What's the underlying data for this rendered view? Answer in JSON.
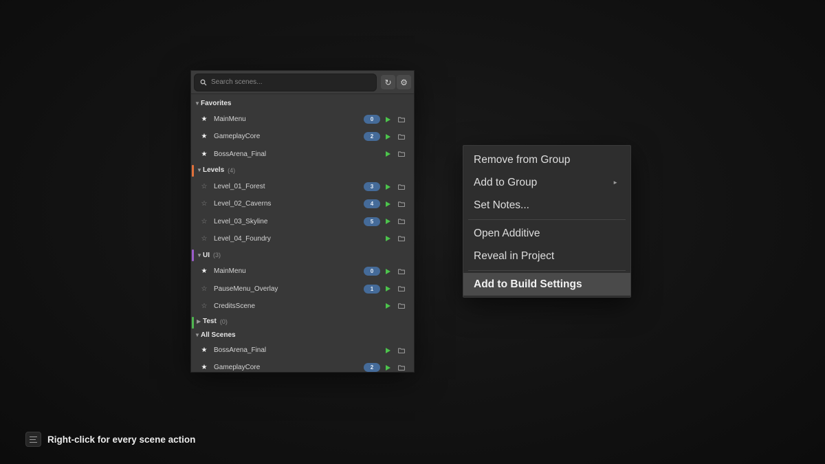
{
  "search": {
    "placeholder": "Search scenes..."
  },
  "toolbar": {
    "refresh_glyph": "↻",
    "settings_glyph": "⚙"
  },
  "groups": {
    "favorites": {
      "label": "Favorites",
      "rows": [
        {
          "name": "MainMenu",
          "badge": "0",
          "starred": true
        },
        {
          "name": "GameplayCore",
          "badge": "2",
          "starred": true
        },
        {
          "name": "BossArena_Final",
          "badge": "",
          "starred": true
        }
      ]
    },
    "levels": {
      "label": "Levels",
      "count": "(4)",
      "accent": "#e0703a",
      "rows": [
        {
          "name": "Level_01_Forest",
          "badge": "3",
          "starred": false
        },
        {
          "name": "Level_02_Caverns",
          "badge": "4",
          "starred": false
        },
        {
          "name": "Level_03_Skyline",
          "badge": "5",
          "starred": false
        },
        {
          "name": "Level_04_Foundry",
          "badge": "",
          "starred": false
        }
      ]
    },
    "ui": {
      "label": "UI",
      "count": "(3)",
      "accent": "#9b5cc9",
      "rows": [
        {
          "name": "MainMenu",
          "badge": "0",
          "starred": true
        },
        {
          "name": "PauseMenu_Overlay",
          "badge": "1",
          "starred": false
        },
        {
          "name": "CreditsScene",
          "badge": "",
          "starred": false
        }
      ]
    },
    "test": {
      "label": "Test",
      "count": "(0)",
      "accent": "#4fb54f"
    },
    "all_scenes": {
      "label": "All Scenes",
      "rows": [
        {
          "name": "BossArena_Final",
          "badge": "",
          "starred": true
        },
        {
          "name": "GameplayCore",
          "badge": "2",
          "starred": true
        }
      ]
    }
  },
  "context_menu": {
    "items": [
      "Remove from Group",
      "Add to Group",
      "Set Notes...",
      "Open Additive",
      "Reveal in Project",
      "Add to Build Settings"
    ]
  },
  "caption": {
    "text": "Right-click for every scene action"
  },
  "icons": {
    "star_filled": "★",
    "star_empty": "☆",
    "caret_open": "▼",
    "caret_closed": "▶",
    "submenu_arrow": "►"
  },
  "colors": {
    "play": "#4cc44c",
    "badge": "#456b99",
    "panel": "#383838"
  }
}
